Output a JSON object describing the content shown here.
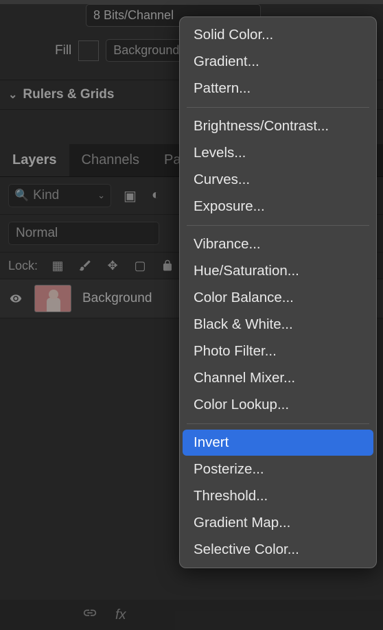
{
  "top": {
    "bits_label": "8 Bits/Channel",
    "fill_label": "Fill",
    "bg_label": "Background Color"
  },
  "rulers_label": "Rulers & Grids",
  "tabs": {
    "layers": "Layers",
    "channels": "Channels",
    "paths": "Paths"
  },
  "layer_filter": {
    "kind_label": "Kind"
  },
  "blend": {
    "mode": "Normal"
  },
  "lock_label": "Lock:",
  "layer": {
    "name": "Background"
  },
  "menu": {
    "group1": [
      "Solid Color...",
      "Gradient...",
      "Pattern..."
    ],
    "group2": [
      "Brightness/Contrast...",
      "Levels...",
      "Curves...",
      "Exposure..."
    ],
    "group3": [
      "Vibrance...",
      "Hue/Saturation...",
      "Color Balance...",
      "Black & White...",
      "Photo Filter...",
      "Channel Mixer...",
      "Color Lookup..."
    ],
    "group4": [
      "Invert",
      "Posterize...",
      "Threshold...",
      "Gradient Map...",
      "Selective Color..."
    ],
    "highlighted": "Invert"
  },
  "bottombar": {
    "link": "",
    "fx": "fx"
  }
}
